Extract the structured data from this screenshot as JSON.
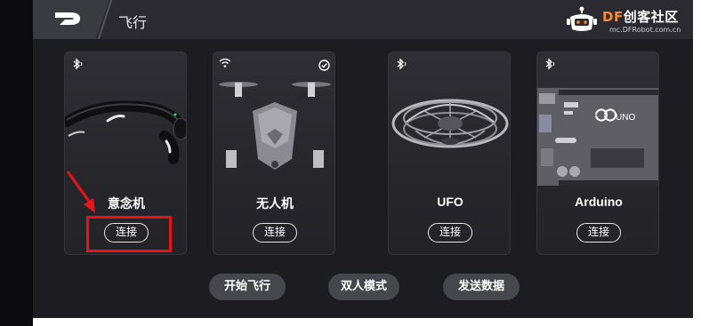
{
  "header": {
    "title": "飞行"
  },
  "brand": {
    "name_prefix": "DF",
    "name_suffix": "创客社区",
    "url": "mc.DFRobot.com.cn"
  },
  "devices": [
    {
      "name": "意念机",
      "connect_label": "连接",
      "status_icon": "bluetooth-icon"
    },
    {
      "name": "无人机",
      "connect_label": "连接",
      "status_icon": "wifi-icon",
      "selected": true
    },
    {
      "name": "UFO",
      "connect_label": "连接",
      "status_icon": "bluetooth-icon"
    },
    {
      "name": "Arduino",
      "connect_label": "连接",
      "status_icon": "bluetooth-icon",
      "board_label": "UNO"
    }
  ],
  "modes": {
    "start_flight": "开始飞行",
    "dual_mode": "双人模式",
    "send_data": "发送数据"
  },
  "colors": {
    "background": "#1d1d21",
    "brand_accent": "#ff8a2a",
    "annotation": "#e8141b"
  }
}
